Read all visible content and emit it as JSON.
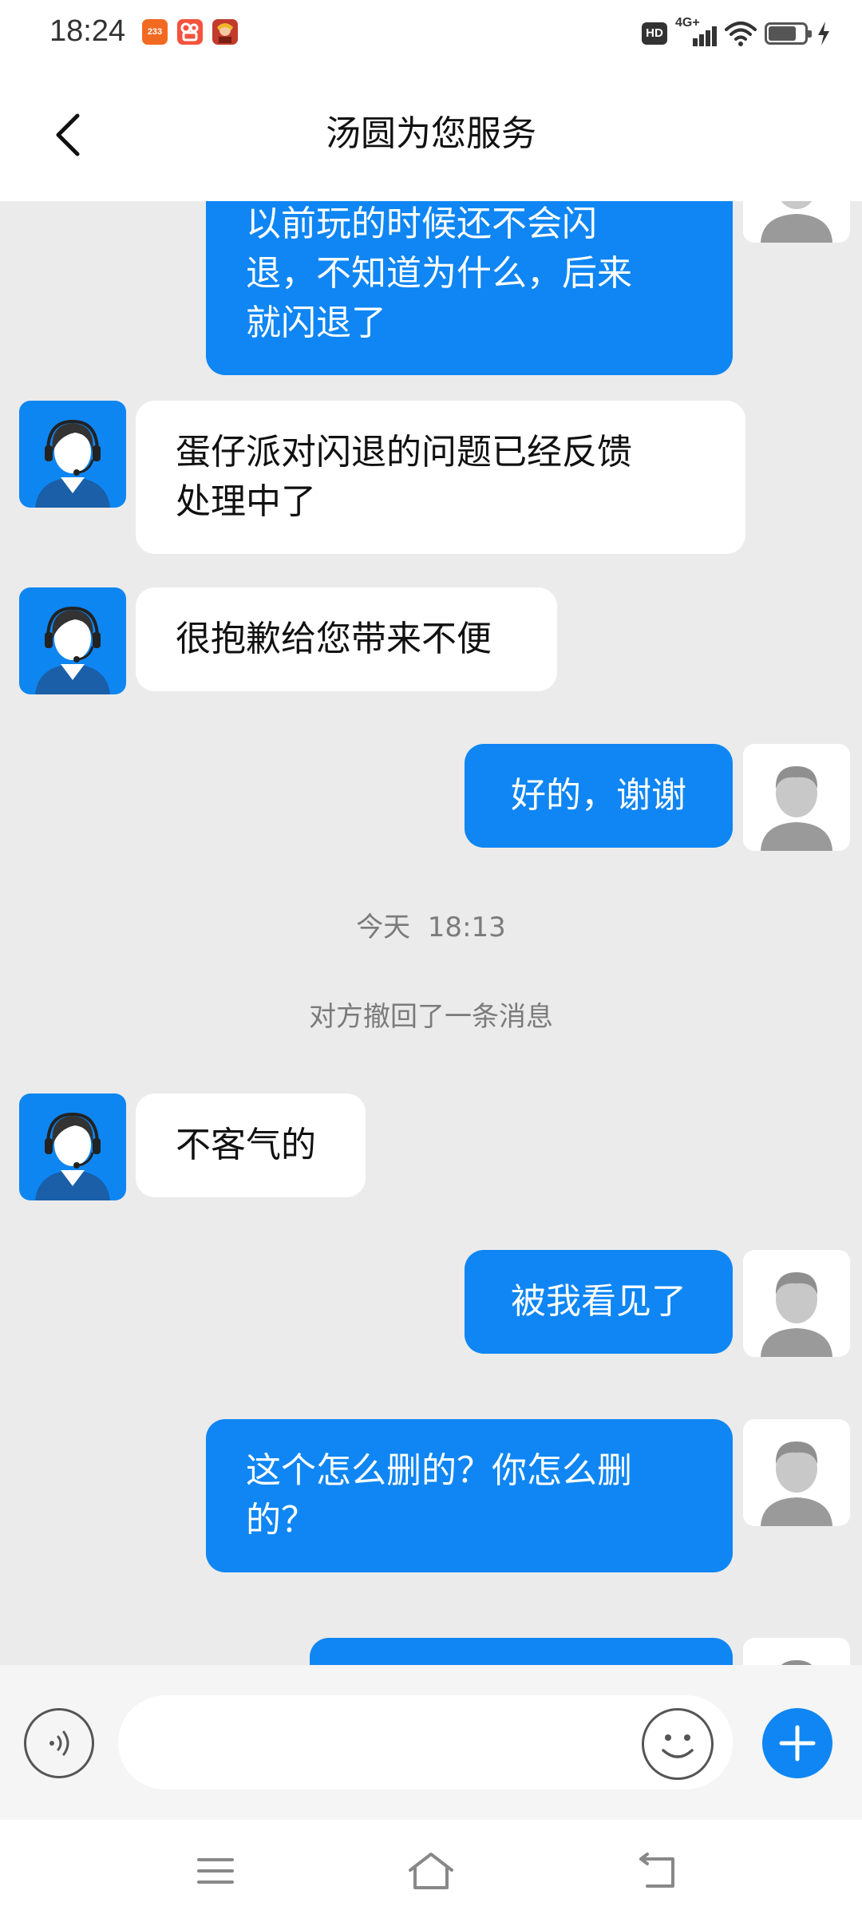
{
  "status_bar": {
    "time": "18:24",
    "app_icons": [
      {
        "name": "app-233-icon",
        "label": "233",
        "color": "#f26a21"
      },
      {
        "name": "kuaishou-icon",
        "label": "",
        "color": "#f5533d"
      },
      {
        "name": "game-avatar-icon",
        "label": "",
        "color": "#c23a2b"
      }
    ],
    "hd": "HD",
    "network": "4G+"
  },
  "header": {
    "title": "汤圆为您服务"
  },
  "colors": {
    "accent": "#0f86f3",
    "chat_bg": "#ebebeb",
    "meta_text": "#7b7b7b"
  },
  "messages": [
    {
      "type": "out",
      "text": "以前玩的时候还不会闪\n退，不知道为什么，后来\n就闪退了"
    },
    {
      "type": "in",
      "text": "蛋仔派对闪退的问题已经反馈\n处理中了"
    },
    {
      "type": "in",
      "text": "很抱歉给您带来不便"
    },
    {
      "type": "out",
      "text": "好的，谢谢"
    },
    {
      "type": "time",
      "text": "今天  18:13"
    },
    {
      "type": "notice",
      "text": "对方撤回了一条消息"
    },
    {
      "type": "in",
      "text": "不客气的"
    },
    {
      "type": "out",
      "text": "被我看见了"
    },
    {
      "type": "out",
      "text": "这个怎么删的？你怎么删\n的？"
    },
    {
      "type": "out",
      "text": ""
    }
  ],
  "input": {
    "placeholder": "",
    "value": ""
  },
  "icons": {
    "back": "back-arrow-icon",
    "voice": "voice-icon",
    "emoji": "emoji-icon",
    "plus": "plus-icon",
    "menu": "menu-icon",
    "home": "home-icon",
    "return": "return-icon"
  }
}
